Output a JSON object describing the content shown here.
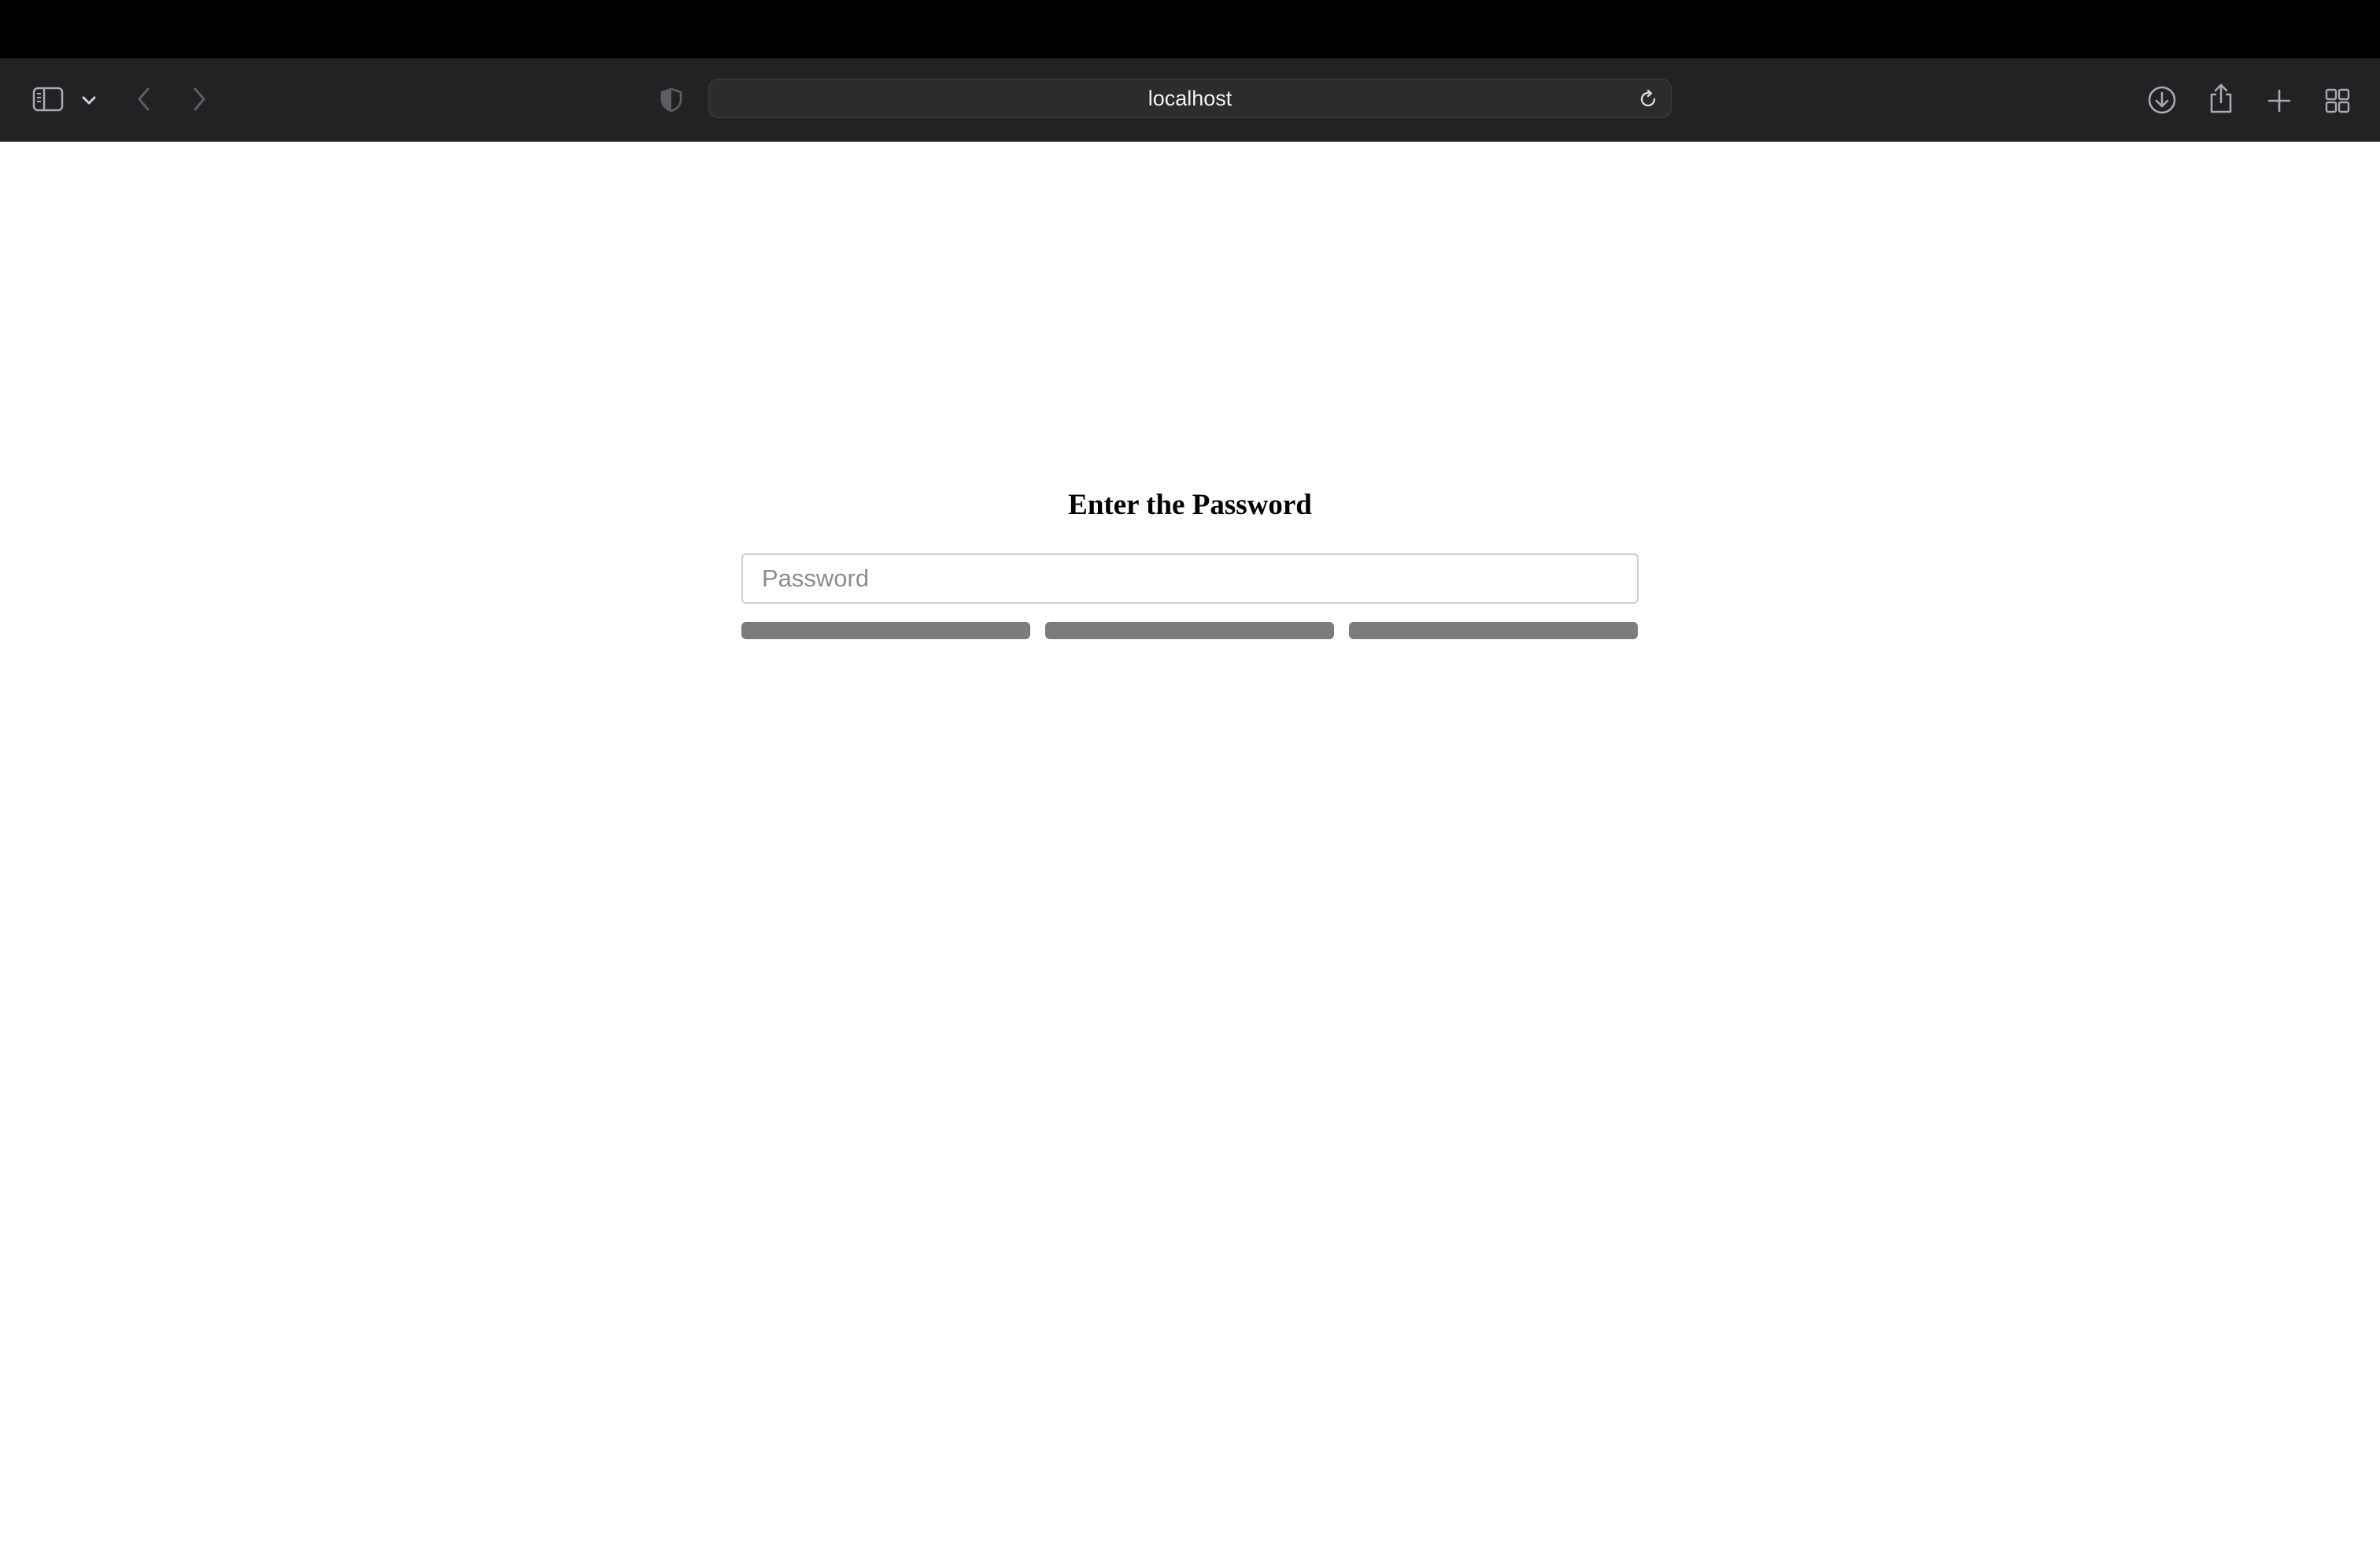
{
  "browser": {
    "address": "localhost",
    "icons": {
      "sidebar": "sidebar-icon",
      "sidebar_menu": "chevron-down-icon",
      "back": "chevron-left-icon",
      "forward": "chevron-right-icon",
      "privacy": "privacy-shield-icon",
      "reload": "reload-icon",
      "downloads": "download-icon",
      "share": "share-icon",
      "new_tab": "plus-icon",
      "tab_overview": "grid-icon"
    }
  },
  "page": {
    "title": "Enter the Password",
    "password_placeholder": "Password",
    "password_value": "",
    "strength_bar_color": "#7b7b7b"
  }
}
